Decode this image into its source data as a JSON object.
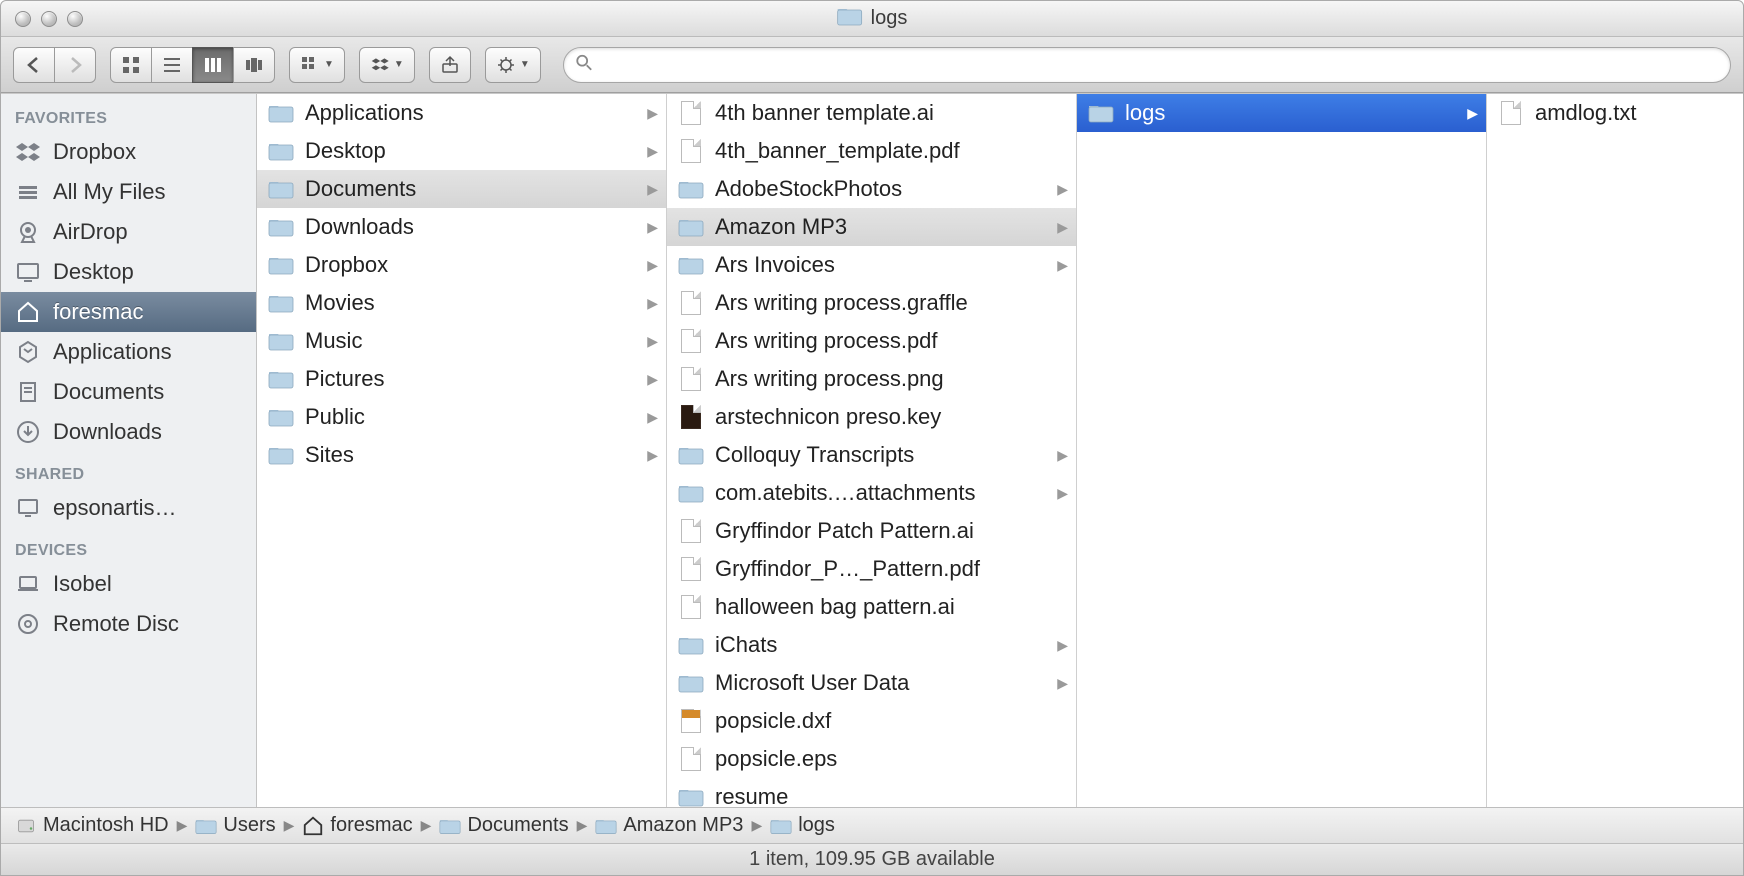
{
  "window": {
    "title": "logs"
  },
  "sidebar": {
    "sections": [
      {
        "header": "FAVORITES",
        "items": [
          {
            "icon": "dropbox",
            "label": "Dropbox"
          },
          {
            "icon": "allfiles",
            "label": "All My Files"
          },
          {
            "icon": "airdrop",
            "label": "AirDrop"
          },
          {
            "icon": "desktop",
            "label": "Desktop"
          },
          {
            "icon": "home",
            "label": "foresmac",
            "selected": true
          },
          {
            "icon": "apps",
            "label": "Applications"
          },
          {
            "icon": "docs",
            "label": "Documents"
          },
          {
            "icon": "downloads",
            "label": "Downloads"
          }
        ]
      },
      {
        "header": "SHARED",
        "items": [
          {
            "icon": "monitor",
            "label": "epsonartis…"
          }
        ]
      },
      {
        "header": "DEVICES",
        "items": [
          {
            "icon": "laptop",
            "label": "Isobel"
          },
          {
            "icon": "disc",
            "label": "Remote Disc"
          }
        ]
      }
    ]
  },
  "columns": [
    [
      {
        "icon": "folder-app",
        "label": "Applications",
        "arrow": true
      },
      {
        "icon": "folder",
        "label": "Desktop",
        "arrow": true
      },
      {
        "icon": "folder",
        "label": "Documents",
        "arrow": true,
        "selected": true
      },
      {
        "icon": "folder",
        "label": "Downloads",
        "arrow": true
      },
      {
        "icon": "folder",
        "label": "Dropbox",
        "arrow": true
      },
      {
        "icon": "folder",
        "label": "Movies",
        "arrow": true
      },
      {
        "icon": "folder",
        "label": "Music",
        "arrow": true
      },
      {
        "icon": "folder",
        "label": "Pictures",
        "arrow": true
      },
      {
        "icon": "folder",
        "label": "Public",
        "arrow": true
      },
      {
        "icon": "folder",
        "label": "Sites",
        "arrow": true
      }
    ],
    [
      {
        "icon": "file",
        "label": "4th banner template.ai"
      },
      {
        "icon": "file-pdf",
        "label": "4th_banner_template.pdf"
      },
      {
        "icon": "folder",
        "label": "AdobeStockPhotos",
        "arrow": true
      },
      {
        "icon": "folder",
        "label": "Amazon MP3",
        "arrow": true,
        "selected": true
      },
      {
        "icon": "folder",
        "label": "Ars Invoices",
        "arrow": true
      },
      {
        "icon": "file-graffle",
        "label": "Ars writing process.graffle"
      },
      {
        "icon": "file-pdf",
        "label": "Ars writing process.pdf"
      },
      {
        "icon": "file-img",
        "label": "Ars writing process.png"
      },
      {
        "icon": "file-dark",
        "label": "arstechnicon preso.key"
      },
      {
        "icon": "folder",
        "label": "Colloquy Transcripts",
        "arrow": true
      },
      {
        "icon": "folder",
        "label": "com.atebits.…attachments",
        "arrow": true
      },
      {
        "icon": "file-ai",
        "label": "Gryffindor Patch Pattern.ai"
      },
      {
        "icon": "file-pdf",
        "label": "Gryffindor_P…_Pattern.pdf"
      },
      {
        "icon": "file-ai",
        "label": "halloween bag pattern.ai"
      },
      {
        "icon": "folder",
        "label": "iChats",
        "arrow": true
      },
      {
        "icon": "folder",
        "label": "Microsoft User Data",
        "arrow": true
      },
      {
        "icon": "file-dxf",
        "label": "popsicle.dxf"
      },
      {
        "icon": "file",
        "label": "popsicle.eps"
      },
      {
        "icon": "folder",
        "label": "resume"
      }
    ],
    [
      {
        "icon": "folder",
        "label": "logs",
        "arrow": true,
        "active": true
      }
    ],
    [
      {
        "icon": "file",
        "label": "amdlog.txt"
      }
    ]
  ],
  "pathbar": [
    {
      "icon": "hdd",
      "label": "Macintosh HD"
    },
    {
      "icon": "folder",
      "label": "Users"
    },
    {
      "icon": "home",
      "label": "foresmac"
    },
    {
      "icon": "folder",
      "label": "Documents"
    },
    {
      "icon": "folder",
      "label": "Amazon MP3"
    },
    {
      "icon": "folder",
      "label": "logs"
    }
  ],
  "status": "1 item, 109.95 GB available",
  "search": {
    "placeholder": ""
  }
}
